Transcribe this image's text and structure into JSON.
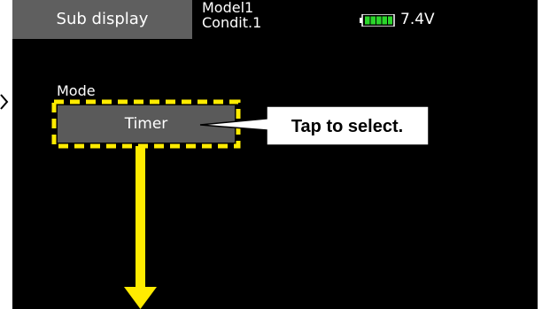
{
  "header": {
    "title_tab": "Sub display",
    "model_name": "Model1",
    "condition": "Condit.1",
    "battery_voltage": "7.4V",
    "battery_icon": "battery-full-icon"
  },
  "mode": {
    "label": "Mode",
    "value": "Timer"
  },
  "annotation": {
    "callout_text": "Tap to select.",
    "highlight_color": "#ffeb00",
    "arrow_color": "#ffeb00"
  },
  "colors": {
    "screen_bg": "#000000",
    "tab_bg": "#5f5f5f",
    "button_bg": "#5a5a5a",
    "battery_green": "#2bd62b"
  }
}
